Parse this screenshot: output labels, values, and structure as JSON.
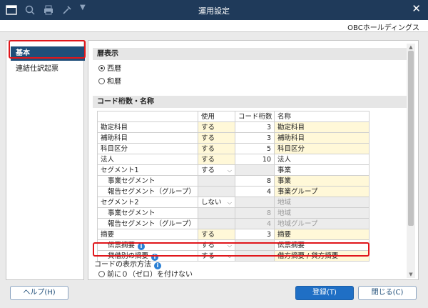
{
  "window": {
    "title": "運用設定",
    "company": "OBCホールディングス"
  },
  "sidebar": {
    "items": [
      {
        "label": "基本"
      },
      {
        "label": "連結仕訳起票"
      }
    ]
  },
  "calendar": {
    "heading": "暦表示",
    "options": [
      {
        "label": "西暦",
        "selected": true
      },
      {
        "label": "和暦",
        "selected": false
      }
    ]
  },
  "codes": {
    "heading": "コード桁数・名称",
    "columns": {
      "use": "使用",
      "digits": "コード桁数",
      "name": "名称"
    },
    "rows": [
      {
        "label": "勘定科目",
        "use": "する",
        "digits": "3",
        "name": "勘定科目"
      },
      {
        "label": "補助科目",
        "use": "する",
        "digits": "3",
        "name": "補助科目"
      },
      {
        "label": "科目区分",
        "use": "する",
        "digits": "5",
        "name": "科目区分"
      },
      {
        "label": "法人",
        "use": "する",
        "digits": "10",
        "name": "法人"
      },
      {
        "label": "セグメント1",
        "use": "する",
        "digits": "",
        "name": "事業"
      },
      {
        "label": "事業セグメント",
        "use": "",
        "digits": "8",
        "name": "事業"
      },
      {
        "label": "報告セグメント（グループ）",
        "use": "",
        "digits": "4",
        "name": "事業グループ"
      },
      {
        "label": "セグメント2",
        "use": "しない",
        "digits": "",
        "name": "地域"
      },
      {
        "label": "事業セグメント",
        "use": "",
        "digits": "8",
        "name": "地域"
      },
      {
        "label": "報告セグメント（グループ）",
        "use": "",
        "digits": "4",
        "name": "地域グループ"
      },
      {
        "label": "摘要",
        "use": "する",
        "digits": "3",
        "name": "摘要"
      },
      {
        "label": "伝票摘要",
        "use": "する",
        "digits": "",
        "name": "伝票摘要"
      },
      {
        "label": "貸借別の摘要",
        "use": "する",
        "digits": "",
        "name": "借方摘要 / 貸方摘要"
      }
    ]
  },
  "code_display": {
    "heading": "コードの表示方法",
    "option": "前に０（ゼロ）を付けない"
  },
  "buttons": {
    "help": "ヘルプ(H)",
    "register": "登録(T)",
    "close": "閉じる(C)"
  },
  "colors": {
    "titlebar": "#1f3a5a",
    "highlight": "#e0161b",
    "active": "#1f4e79"
  }
}
